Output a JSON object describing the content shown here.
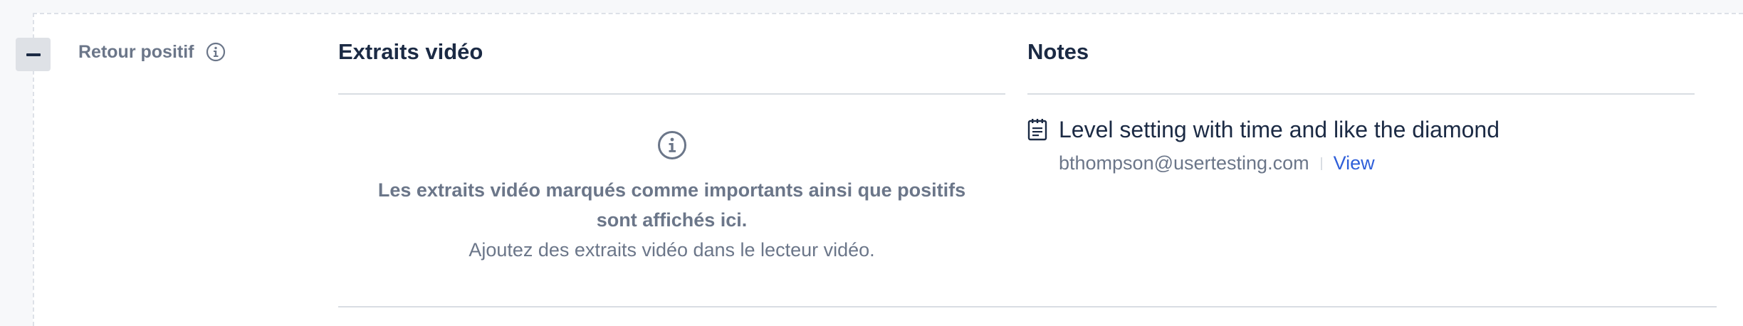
{
  "section": {
    "label": "Retour positif",
    "collapse_icon": "minus-icon",
    "info_icon": "info-icon"
  },
  "video_column": {
    "title": "Extraits vidéo",
    "empty_icon": "info-icon",
    "empty_message": "Les extraits vidéo marqués comme importants ainsi que positifs sont affichés ici.",
    "empty_hint": "Ajoutez des extraits vidéo dans le lecteur vidéo."
  },
  "notes_column": {
    "title": "Notes",
    "notes": [
      {
        "icon": "note-icon",
        "text": "Level setting with time and like the diamond",
        "author": "bthompson@usertesting.com",
        "action_label": "View"
      }
    ]
  },
  "colors": {
    "heading": "#1b2a44",
    "muted": "#6b7689",
    "link": "#2f5fd9",
    "divider": "#d9dde3"
  }
}
